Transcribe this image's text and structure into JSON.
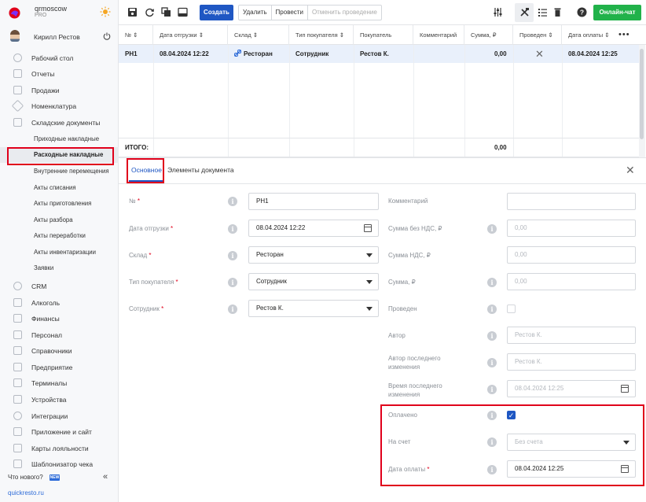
{
  "brand": {
    "name": "qrmoscow",
    "plan": "PRO"
  },
  "user": {
    "name": "Кирилл Рестов"
  },
  "nav": {
    "items_top": [
      "Рабочий стол",
      "Отчеты",
      "Продажи",
      "Номенклатура",
      "Складские документы"
    ],
    "sub_items": [
      "Приходные накладные",
      "Расходные накладные",
      "Внутренние перемещения",
      "Акты списания",
      "Акты приготовления",
      "Акты разбора",
      "Акты переработки",
      "Акты инвентаризации",
      "Заявки"
    ],
    "items_bottom": [
      "CRM",
      "Алкоголь",
      "Финансы",
      "Персонал",
      "Справочники",
      "Предприятие",
      "Терминалы",
      "Устройства",
      "Интеграции",
      "Приложение и сайт",
      "Карты лояльности",
      "Шаблонизатор чека"
    ],
    "whats_new": "Что нового?",
    "new_badge": "NEW",
    "site": "quickresto.ru"
  },
  "toolbar": {
    "create": "Создать",
    "delete": "Удалить",
    "post": "Провести",
    "unpost": "Отменить проведение",
    "chat": "Онлайн-чат"
  },
  "table": {
    "headers": [
      "№ ⇕",
      "Дата отгрузки ⇕",
      "Склад ⇕",
      "Тип покупателя ⇕",
      "Покупатель",
      "Комментарий",
      "Сумма, ₽",
      "Проведен ⇕",
      "Дата оплаты ⇕"
    ],
    "row": {
      "num": "РН1",
      "date": "08.04.2024 12:22",
      "warehouse": "Ресторан",
      "buyer_type": "Сотрудник",
      "buyer": "Рестов К.",
      "comment": "",
      "sum": "0,00",
      "posted": "✕",
      "pay_date": "08.04.2024 12:25"
    },
    "total_label": "ИТОГО:",
    "total_sum": "0,00"
  },
  "panel": {
    "tabs": [
      "Основное",
      "Элементы документа"
    ],
    "left": {
      "num": {
        "label": "№",
        "value": "РН1"
      },
      "ship_date": {
        "label": "Дата отгрузки",
        "value": "08.04.2024 12:22"
      },
      "warehouse": {
        "label": "Склад",
        "value": "Ресторан"
      },
      "buyer_type": {
        "label": "Тип покупателя",
        "value": "Сотрудник"
      },
      "employee": {
        "label": "Сотрудник",
        "value": "Рестов К."
      }
    },
    "right": {
      "comment": {
        "label": "Комментарий",
        "value": ""
      },
      "sum_no_vat": {
        "label": "Сумма без НДС, ₽",
        "value": "0,00"
      },
      "vat": {
        "label": "Сумма НДС, ₽",
        "value": "0,00"
      },
      "sum": {
        "label": "Сумма, ₽",
        "value": "0,00"
      },
      "posted": {
        "label": "Проведен"
      },
      "author": {
        "label": "Автор",
        "value": "Рестов К."
      },
      "last_author": {
        "label": "Автор последнего изменения",
        "value": "Рестов К."
      },
      "last_time": {
        "label": "Время последнего изменения",
        "value": "08.04.2024 12:25"
      },
      "paid": {
        "label": "Оплачено",
        "checked": true
      },
      "account": {
        "label": "На счет",
        "value": "Без счета"
      },
      "pay_date": {
        "label": "Дата оплаты",
        "value": "08.04.2024 12:25"
      }
    },
    "required_mark": "*"
  },
  "colors": {
    "accent": "#1f57c3",
    "chat": "#21b24a",
    "highlight": "#e0001b"
  }
}
